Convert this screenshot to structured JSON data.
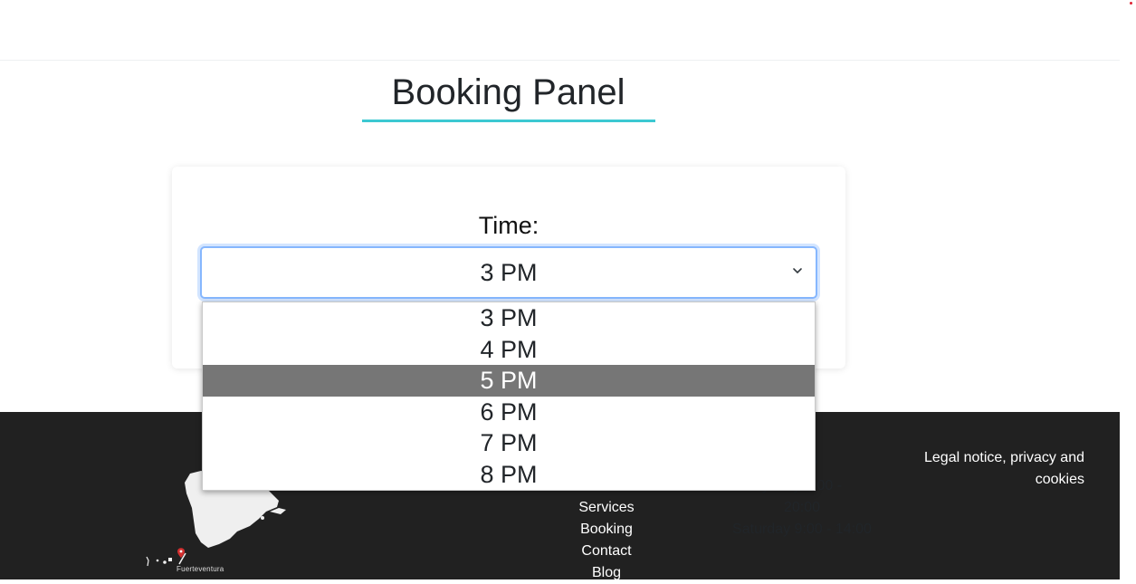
{
  "page": {
    "title": "Booking Panel"
  },
  "form": {
    "time_label": "Time:",
    "time_selected": "3 PM",
    "time_options": [
      "3 PM",
      "4 PM",
      "5 PM",
      "6 PM",
      "7 PM",
      "8 PM"
    ],
    "highlighted_option": "5 PM"
  },
  "footer": {
    "map_caption": "Fuerteventura",
    "nav_links": [
      "Services",
      "Booking",
      "Contact",
      "Blog"
    ],
    "hours_title": "ours",
    "hours_line_1": "y    ay 8:00 -",
    "hours_line_2": "20:00",
    "hours_line_3": "Saturday 9:00 - 14:00",
    "legal_link": "Legal notice, privacy and cookies"
  },
  "colors": {
    "accent": "#3cc8d2",
    "footer_bg": "#212121",
    "focus_ring": "#86b7fe",
    "option_highlight": "#767676",
    "map_pin": "#d32f2f"
  },
  "icons": [
    "chevron-down-icon",
    "map-pin-icon"
  ]
}
